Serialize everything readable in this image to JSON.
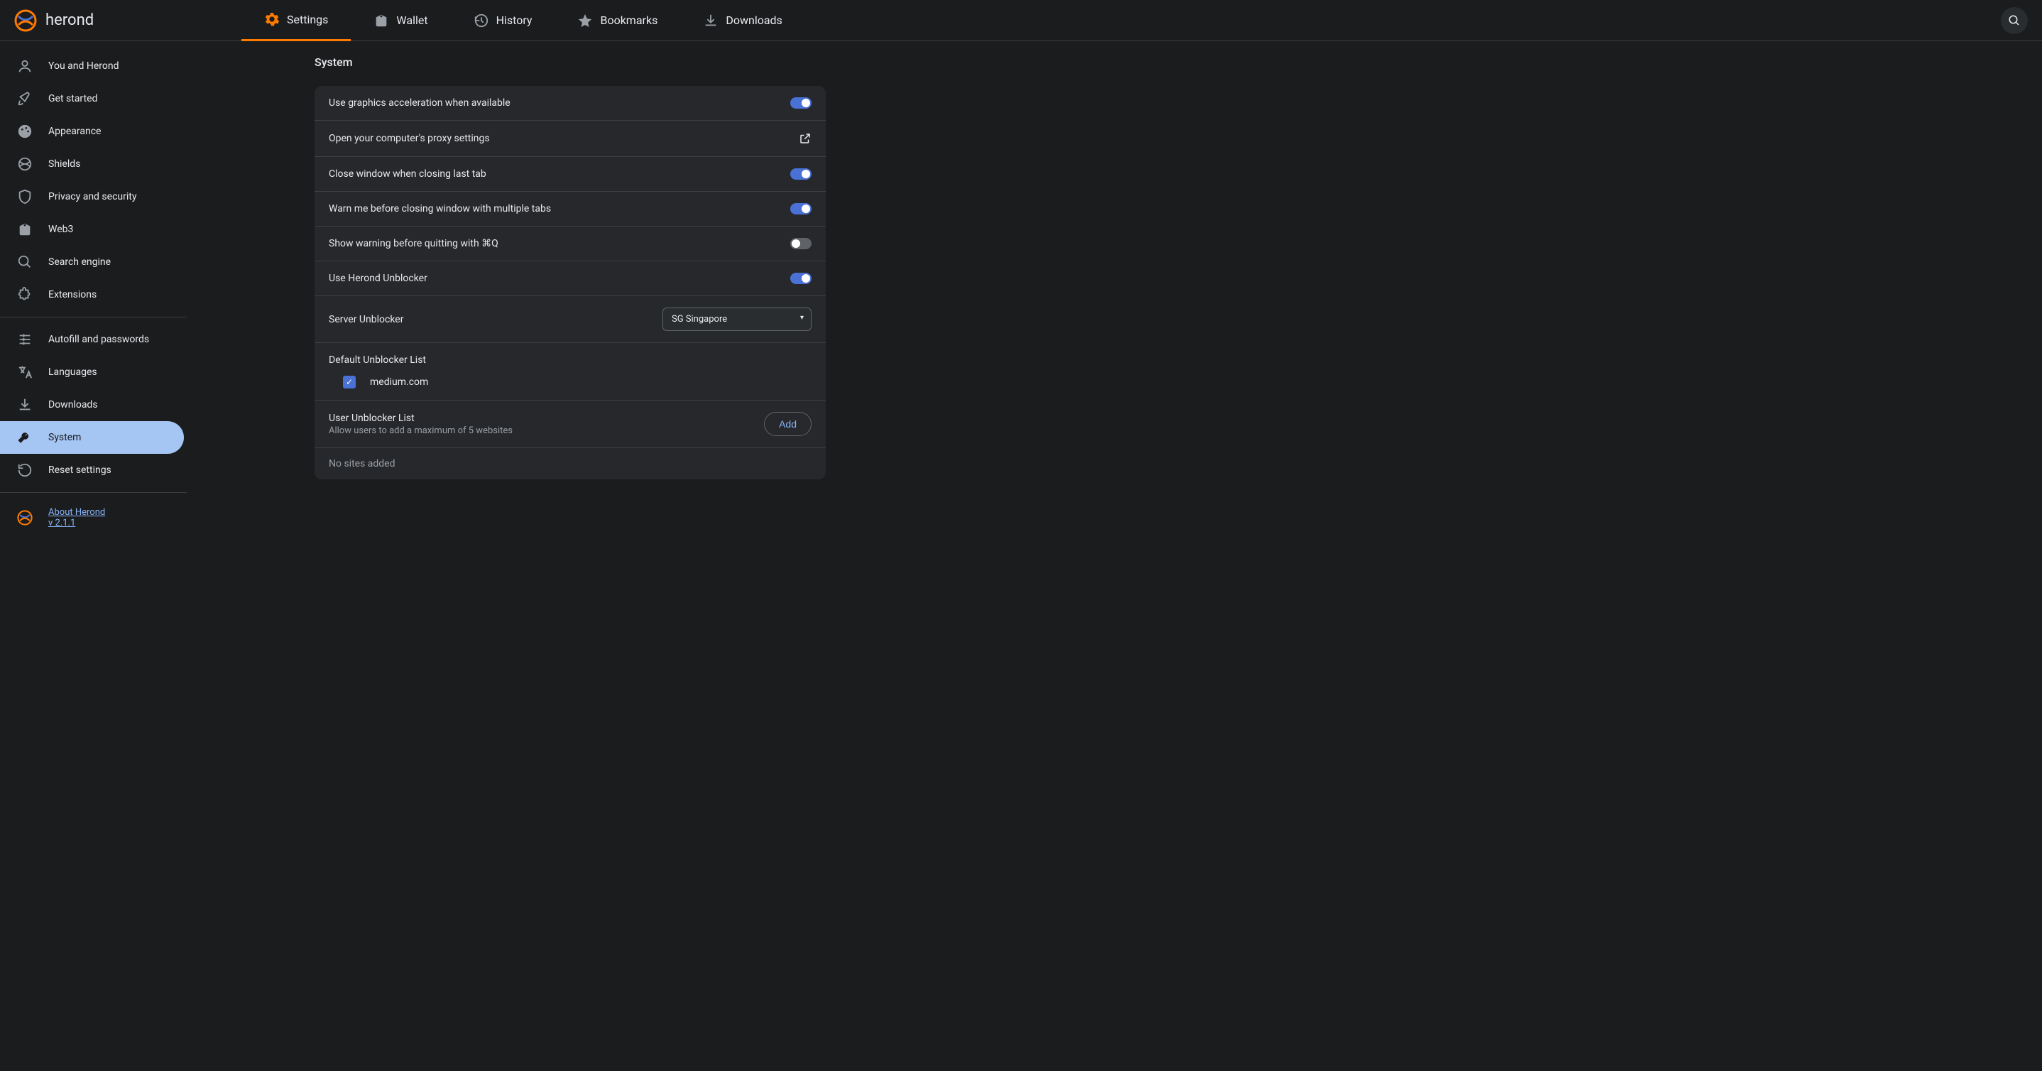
{
  "brand": "herond",
  "header_tabs": [
    {
      "label": "Settings",
      "icon": "gear",
      "active": true
    },
    {
      "label": "Wallet",
      "icon": "wallet",
      "active": false
    },
    {
      "label": "History",
      "icon": "history",
      "active": false
    },
    {
      "label": "Bookmarks",
      "icon": "star",
      "active": false
    },
    {
      "label": "Downloads",
      "icon": "download",
      "active": false
    }
  ],
  "sidebar": {
    "groups": [
      [
        {
          "label": "You and Herond",
          "icon": "person"
        },
        {
          "label": "Get started",
          "icon": "rocket"
        },
        {
          "label": "Appearance",
          "icon": "palette"
        },
        {
          "label": "Shields",
          "icon": "herond-shield"
        },
        {
          "label": "Privacy and security",
          "icon": "shield"
        },
        {
          "label": "Web3",
          "icon": "wallet"
        },
        {
          "label": "Search engine",
          "icon": "search"
        },
        {
          "label": "Extensions",
          "icon": "extension"
        }
      ],
      [
        {
          "label": "Autofill and passwords",
          "icon": "autofill"
        },
        {
          "label": "Languages",
          "icon": "translate"
        },
        {
          "label": "Downloads",
          "icon": "download"
        },
        {
          "label": "System",
          "icon": "wrench",
          "active": true
        },
        {
          "label": "Reset settings",
          "icon": "reset"
        }
      ]
    ],
    "about": {
      "label": "About Herond",
      "version": "v 2.1.1"
    }
  },
  "page": {
    "title": "System",
    "settings": [
      {
        "type": "toggle",
        "label": "Use graphics acceleration when available",
        "on": true
      },
      {
        "type": "link",
        "label": "Open your computer's proxy settings"
      },
      {
        "type": "toggle",
        "label": "Close window when closing last tab",
        "on": true
      },
      {
        "type": "toggle",
        "label": "Warn me before closing window with multiple tabs",
        "on": true
      },
      {
        "type": "toggle",
        "label": "Show warning before quitting with ⌘Q",
        "on": false
      },
      {
        "type": "toggle",
        "label": "Use Herond Unblocker",
        "on": true
      },
      {
        "type": "select",
        "label": "Server Unblocker",
        "value": "SG Singapore"
      }
    ],
    "default_unblocker": {
      "title": "Default Unblocker List",
      "items": [
        {
          "domain": "medium.com",
          "checked": true
        }
      ]
    },
    "user_unblocker": {
      "title": "User Unblocker List",
      "subtitle": "Allow users to add a maximum of 5 websites",
      "add_label": "Add",
      "empty_text": "No sites added"
    }
  }
}
